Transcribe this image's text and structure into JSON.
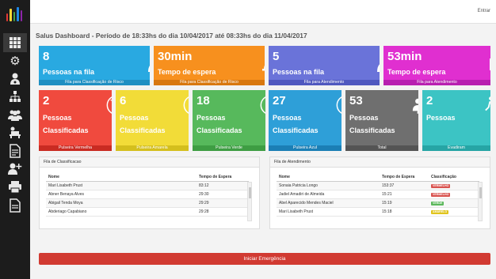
{
  "header": {
    "entrar": "Entrar"
  },
  "page_title": "Salus Dashboard - Período de 18:33hs do dia 10/04/2017 até 08:33hs do dia 11/04/2017",
  "sidebar": {
    "logo_colors": [
      "#e53935",
      "#fdd835",
      "#43a047",
      "#1e88e5",
      "#8e24aa"
    ],
    "icons": [
      "grid-icon",
      "gear-icon",
      "user-doctor-icon",
      "org-chart-icon",
      "group-icon",
      "bed-icon",
      "report-icon",
      "add-user-icon",
      "printer-icon",
      "document-icon"
    ]
  },
  "top_tiles": [
    {
      "value": "8",
      "label": "Pessoas na fila",
      "footer": "Fila para Classificação de Risco",
      "color": "#29a9e1",
      "foot_color": "#1f8fc2",
      "icon": "nurse-icon"
    },
    {
      "value": "30min",
      "label": "Tempo de espera",
      "footer": "Fila para Classificação de Risco",
      "color": "#f7901e",
      "foot_color": "#d8780f",
      "icon": "clock-user-icon"
    },
    {
      "value": "5",
      "label": "Pessoas na fila",
      "footer": "Fila para Atendimento",
      "color": "#6a73d9",
      "foot_color": "#4f58bf",
      "icon": "doctor-icon"
    },
    {
      "value": "53min",
      "label": "Tempo de espera",
      "footer": "Fila para Atendimento",
      "color": "#e02fd0",
      "foot_color": "#b81fb0",
      "icon": "waiting-chair-icon"
    }
  ],
  "class_tiles": [
    {
      "value": "2",
      "label1": "Pessoas",
      "label2": "Classificadas",
      "footer": "Pulseira Vermelha",
      "color": "#f04a3e",
      "foot_color": "#c92b22",
      "icon": "angry-face-icon"
    },
    {
      "value": "6",
      "label1": "Pessoas",
      "label2": "Classificadas",
      "footer": "Pulseira Amarela",
      "color": "#f2dc38",
      "foot_color": "#d4bf1d",
      "icon": "sad-face-icon"
    },
    {
      "value": "18",
      "label1": "Pessoas",
      "label2": "Classificadas",
      "footer": "Pulseira Verde",
      "color": "#57b95c",
      "foot_color": "#3e9d43",
      "icon": "neutral-face-icon"
    },
    {
      "value": "27",
      "label1": "Pessoas",
      "label2": "Classificadas",
      "footer": "Pulseira Azul",
      "color": "#2e9fd8",
      "foot_color": "#1b7fb5",
      "icon": "smile-face-icon"
    },
    {
      "value": "53",
      "label1": "Pessoas",
      "label2": "Classificadas",
      "footer": "Total",
      "color": "#6f6f6f",
      "foot_color": "#545454",
      "icon": "people-icon"
    },
    {
      "value": "2",
      "label1": "Pessoas",
      "label2": "",
      "footer": "Evadiram",
      "color": "#3cc4c4",
      "foot_color": "#26a5a5",
      "icon": "exit-icon"
    }
  ],
  "fila_classificacao": {
    "title": "Fila de Classificacao",
    "headers": [
      "Nome",
      "Tempo de Espera"
    ],
    "rows": [
      [
        "Mari Lisabeth Prust",
        "83:12"
      ],
      [
        "Abner Benaya Alves",
        "29:30"
      ],
      [
        "Abigail Tenda Moya",
        "29:29"
      ],
      [
        "Abderiago Capabiano",
        "29:28"
      ]
    ]
  },
  "fila_atendimento": {
    "title": "Fila de Atendimento",
    "headers": [
      "Nome",
      "Tempo de Espera",
      "Classificação"
    ],
    "rows": [
      [
        "Sonaia Patricia Longo",
        "153:37",
        "VERMELHO",
        "#d9534f"
      ],
      [
        "Jadiel Amadiri de Almeida",
        "15:21",
        "VERMELHO",
        "#d9534f"
      ],
      [
        "Abel Aparecido Mendes Maciel",
        "15:19",
        "VERDE",
        "#5cb85c"
      ],
      [
        "Mari Lisabeth Prust",
        "15:18",
        "AMARELO",
        "#e0c41c"
      ]
    ]
  },
  "emergency_button": "Iniciar Emergência"
}
